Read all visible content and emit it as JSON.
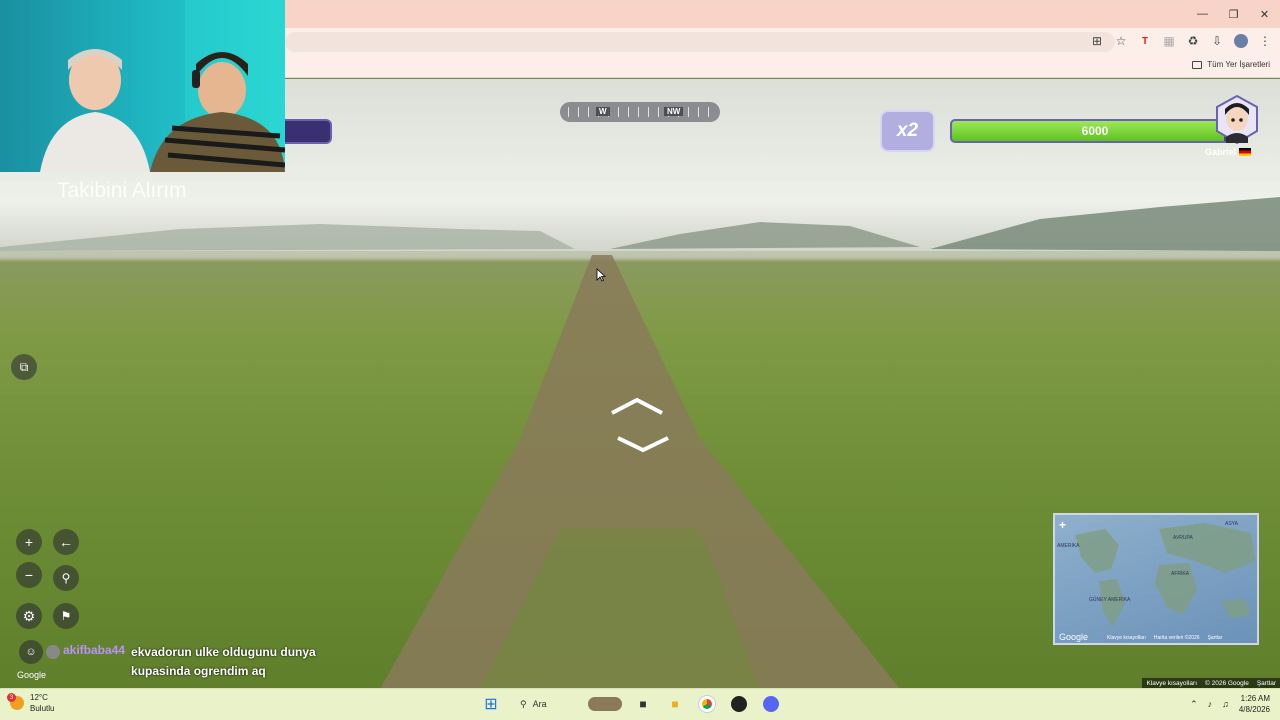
{
  "browser": {
    "bookmarks_all_label": "Tüm Yer İşaretleri"
  },
  "hud": {
    "compass_w": "W",
    "compass_nw": "NW",
    "multiplier": "x2",
    "health_value": "6000",
    "health_fraction": 0.95,
    "player_name": "Gabriel"
  },
  "minimap": {
    "labels": [
      "ASYA",
      "AVRUPA",
      "AFRİKA",
      "GÜNEY AMERİKA",
      "AMERİKA"
    ],
    "footer": [
      "Klavye kısayolları",
      "Harita verileri ©2026",
      "Şartlar"
    ],
    "google": "Google"
  },
  "attribution": {
    "shortcuts": "Klavye kısayolları",
    "copyright": "© 2026 Google",
    "terms": "Şartlar"
  },
  "google_logo": "Google",
  "chat": {
    "username": "akifbaba44",
    "message": "ekvadorun ulke oldugunu dunya kupasinda ogrendim aq"
  },
  "stream_overlay": {
    "subtitle": "Takibini Alırım"
  },
  "taskbar": {
    "temperature": "12°C",
    "condition": "Bulutlu",
    "weather_badge": "3",
    "search_placeholder": "Ara",
    "time": "1:26 AM",
    "date": "4/8/2026"
  }
}
